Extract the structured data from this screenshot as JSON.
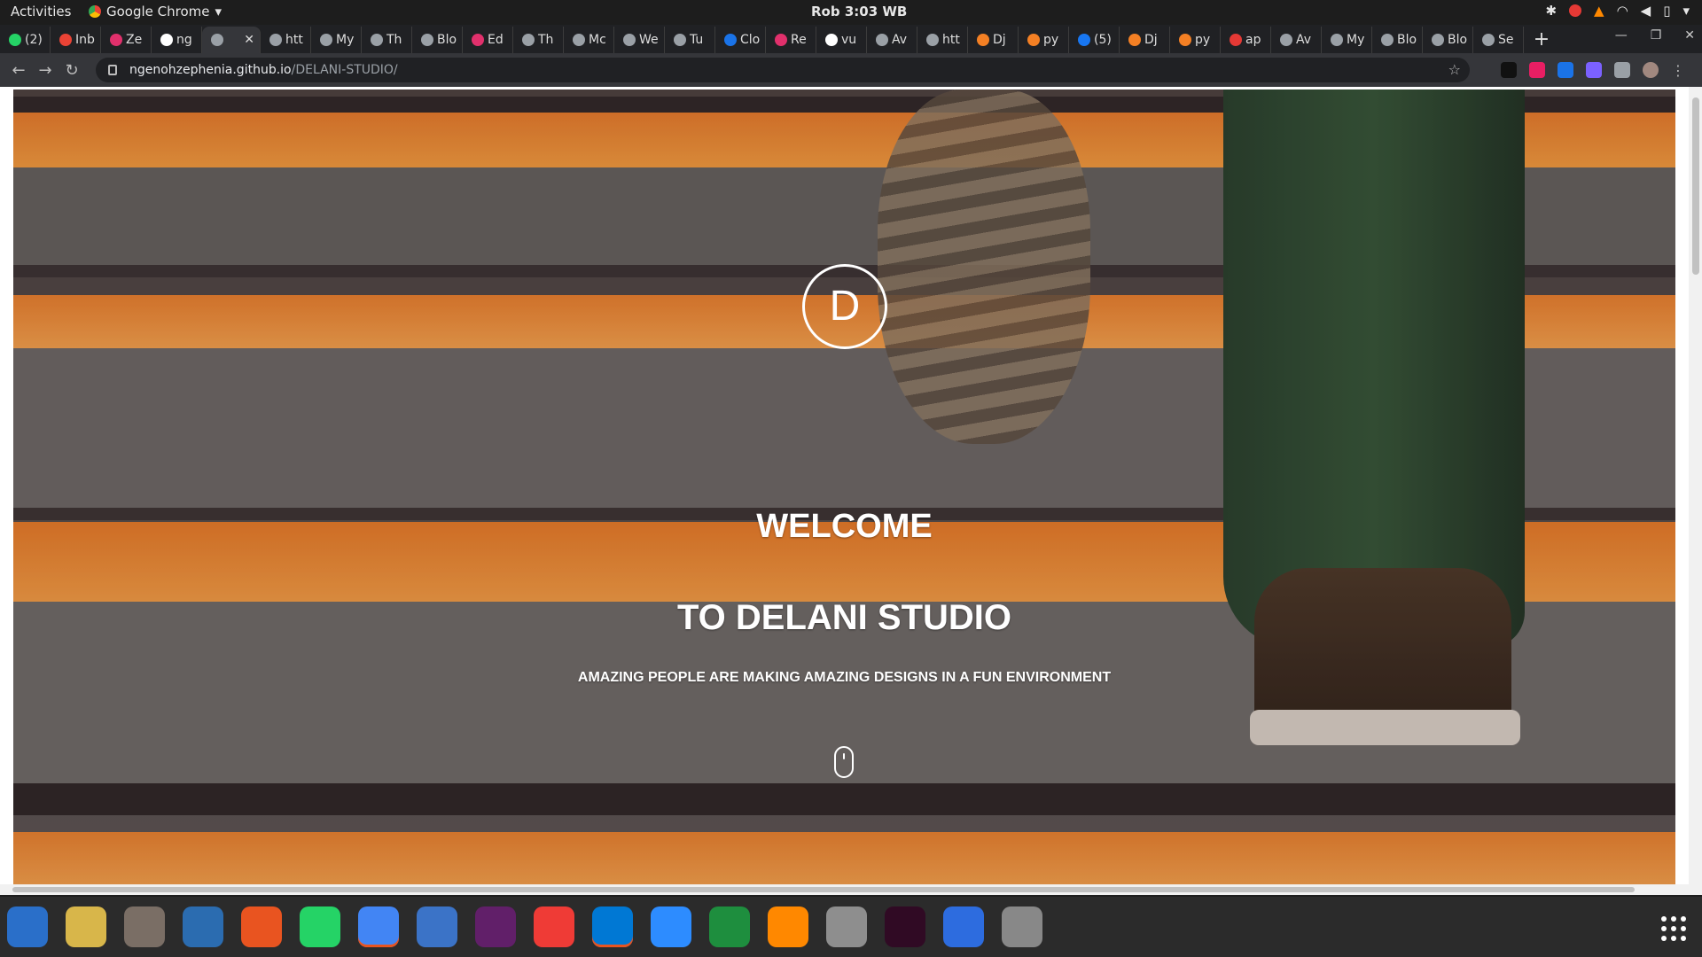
{
  "system_bar": {
    "activities": "Activities",
    "app_name": "Google Chrome",
    "clock": "Rob  3:03 WB"
  },
  "tabs": [
    {
      "label": "(2)",
      "icon": "whatsapp-icon",
      "color": "#25d366"
    },
    {
      "label": "Inb",
      "icon": "gmail-icon",
      "color": "#ea4335"
    },
    {
      "label": "Ze",
      "icon": "instagram-icon",
      "color": "#e1306c"
    },
    {
      "label": "ng",
      "icon": "github-icon",
      "color": "#ffffff"
    },
    {
      "label": "",
      "icon": "globe-icon",
      "color": "#9aa0a6",
      "active": true
    },
    {
      "label": "htt",
      "icon": "globe-icon",
      "color": "#9aa0a6"
    },
    {
      "label": "My",
      "icon": "globe-icon",
      "color": "#9aa0a6"
    },
    {
      "label": "Th",
      "icon": "globe-icon",
      "color": "#9aa0a6"
    },
    {
      "label": "Blo",
      "icon": "globe-icon",
      "color": "#9aa0a6"
    },
    {
      "label": "Ed",
      "icon": "instagram-icon",
      "color": "#e1306c"
    },
    {
      "label": "Th",
      "icon": "tree-icon",
      "color": "#9aa0a6"
    },
    {
      "label": "Mc",
      "icon": "tree-icon",
      "color": "#9aa0a6"
    },
    {
      "label": "We",
      "icon": "tree-icon",
      "color": "#9aa0a6"
    },
    {
      "label": "Tu",
      "icon": "tree-icon",
      "color": "#9aa0a6"
    },
    {
      "label": "Clo",
      "icon": "cloud-icon",
      "color": "#1a73e8"
    },
    {
      "label": "Re",
      "icon": "instagram-icon",
      "color": "#e1306c"
    },
    {
      "label": "vu",
      "icon": "github-icon",
      "color": "#ffffff"
    },
    {
      "label": "Av",
      "icon": "globe-icon",
      "color": "#9aa0a6"
    },
    {
      "label": "htt",
      "icon": "globe-icon",
      "color": "#9aa0a6"
    },
    {
      "label": "Dj",
      "icon": "stackoverflow-icon",
      "color": "#f48024"
    },
    {
      "label": "py",
      "icon": "stackoverflow-icon",
      "color": "#f48024"
    },
    {
      "label": "(5)",
      "icon": "facebook-icon",
      "color": "#1877f2"
    },
    {
      "label": "Dj",
      "icon": "stackoverflow-icon",
      "color": "#f48024"
    },
    {
      "label": "py",
      "icon": "stackoverflow-icon",
      "color": "#f48024"
    },
    {
      "label": "ap",
      "icon": "ask-icon",
      "color": "#e53935"
    },
    {
      "label": "Av",
      "icon": "globe-icon",
      "color": "#9aa0a6"
    },
    {
      "label": "My",
      "icon": "globe-icon",
      "color": "#9aa0a6"
    },
    {
      "label": "Blo",
      "icon": "globe-icon",
      "color": "#9aa0a6"
    },
    {
      "label": "Blo",
      "icon": "globe-icon",
      "color": "#9aa0a6"
    },
    {
      "label": "Se",
      "icon": "globe-icon",
      "color": "#9aa0a6"
    }
  ],
  "address": {
    "domain": "ngenohzephenia.github.io",
    "path": "/DELANI-STUDIO/"
  },
  "hero": {
    "logo_letter": "D",
    "welcome": "WELCOME",
    "title": "TO DELANI STUDIO",
    "tagline": "AMAZING PEOPLE ARE MAKING AMAZING DESIGNS IN A FUN ENVIRONMENT"
  },
  "dock": [
    {
      "name": "thunderbird-icon",
      "color": "#2a6fc9"
    },
    {
      "name": "rhythmbox-icon",
      "color": "#d8b64a"
    },
    {
      "name": "files-icon",
      "color": "#7a6e65"
    },
    {
      "name": "writer-icon",
      "color": "#2b6cb0"
    },
    {
      "name": "software-icon",
      "color": "#e95420"
    },
    {
      "name": "whatsapp-icon",
      "color": "#25d366"
    },
    {
      "name": "chrome-icon",
      "color": "#4285f4",
      "running": true
    },
    {
      "name": "help-icon",
      "color": "#3b73c7"
    },
    {
      "name": "slack-icon",
      "color": "#611f69"
    },
    {
      "name": "anydesk-icon",
      "color": "#ef3b36"
    },
    {
      "name": "vscode-icon",
      "color": "#0078d4",
      "running": true
    },
    {
      "name": "zoom-icon",
      "color": "#2d8cff"
    },
    {
      "name": "calc-icon",
      "color": "#1e8e3e"
    },
    {
      "name": "vlc-icon",
      "color": "#ff8800"
    },
    {
      "name": "image-viewer-icon",
      "color": "#8e8e8e"
    },
    {
      "name": "terminal-icon",
      "color": "#300a24"
    },
    {
      "name": "remote-desktop-icon",
      "color": "#2d6cdf"
    },
    {
      "name": "settings-icon",
      "color": "#888888"
    }
  ]
}
